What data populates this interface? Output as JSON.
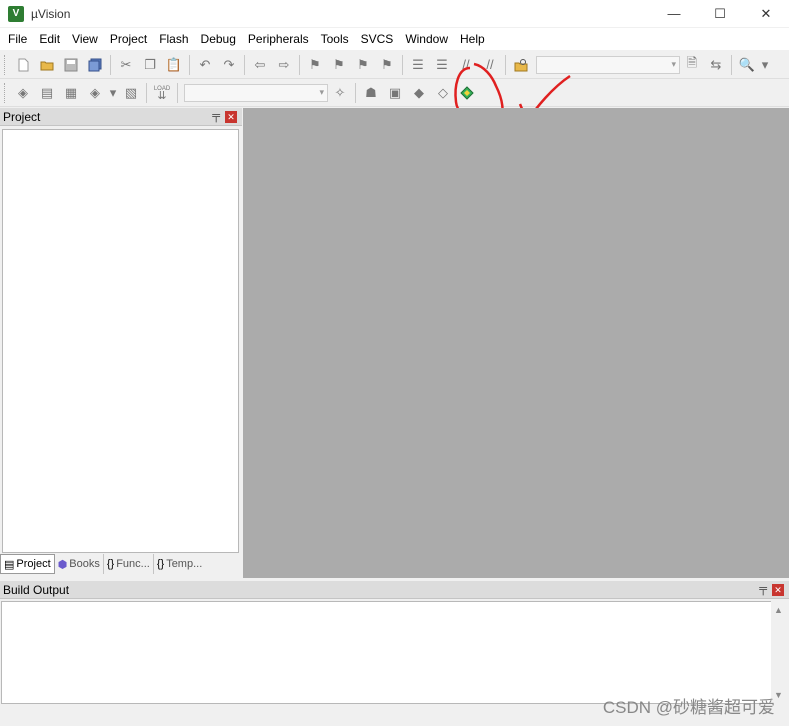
{
  "window": {
    "title": "µVision",
    "app_icon_text": "V",
    "minimize_glyph": "—",
    "maximize_glyph": "☐",
    "close_glyph": "✕"
  },
  "menu": {
    "items": [
      "File",
      "Edit",
      "View",
      "Project",
      "Flash",
      "Debug",
      "Peripherals",
      "Tools",
      "SVCS",
      "Window",
      "Help"
    ]
  },
  "toolbar1": {
    "icons": [
      "new-file-icon",
      "open-folder-icon",
      "save-icon",
      "save-all-icon",
      "cut-icon",
      "copy-icon",
      "paste-icon",
      "undo-icon",
      "redo-icon",
      "nav-back-icon",
      "nav-forward-icon",
      "bookmark-icon",
      "bookmark-prev-icon",
      "bookmark-next-icon",
      "bookmark-clear-icon",
      "indent-icon",
      "unindent-icon",
      "comment-icon",
      "uncomment-icon",
      "find-in-files-icon",
      "zoom-icon"
    ],
    "combo_value": ""
  },
  "toolbar2": {
    "icons": [
      "translate-icon",
      "build-icon",
      "rebuild-icon",
      "batch-build-icon",
      "stop-build-icon",
      "download-icon",
      "target-options-icon",
      "manage-components-icon",
      "select-packs-icon",
      "pack-installer-icon",
      "green-diamond-icon"
    ],
    "load_label": "LOAD",
    "target_value": ""
  },
  "project_pane": {
    "title": "Project",
    "pin_glyph": "📌",
    "close_glyph": "✕",
    "tabs": [
      {
        "label": "Project",
        "icon": "project-tab-icon"
      },
      {
        "label": "Books",
        "icon": "books-tab-icon"
      },
      {
        "label": "Func...",
        "icon": "functions-tab-icon"
      },
      {
        "label": "Temp...",
        "icon": "templates-tab-icon"
      }
    ]
  },
  "build_output": {
    "title": "Build Output",
    "pin_glyph": "📌",
    "close_glyph": "✕"
  },
  "watermark": "CSDN @砂糖酱超可爱",
  "colors": {
    "editor_bg": "#ababab",
    "annotation": "#e02020",
    "app_icon": "#2e7d32"
  }
}
